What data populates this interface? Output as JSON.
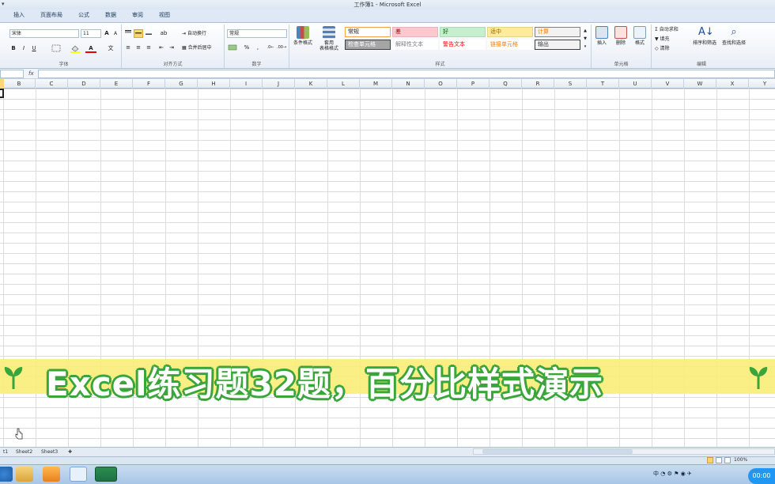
{
  "window": {
    "title": "工作簿1 - Microsoft Excel"
  },
  "tabs": [
    "插入",
    "页面布局",
    "公式",
    "数据",
    "审阅",
    "视图"
  ],
  "ribbon": {
    "font": {
      "name": "宋体",
      "size": "11",
      "grow": "A",
      "shrink": "A",
      "bold": "B",
      "italic": "I",
      "underline": "U",
      "label": "字体"
    },
    "alignment": {
      "wrap": "自动换行",
      "merge": "合并后居中",
      "label": "对齐方式"
    },
    "number": {
      "format": "常规",
      "percent": "%",
      "comma": ",",
      "label": "数字"
    },
    "styles": {
      "conditional": "条件格式",
      "table_line1": "套用",
      "table_line2": "表格格式",
      "cells": [
        {
          "text": "常规",
          "bg": "#ffffff",
          "color": "#222222",
          "border": "#f5a64a"
        },
        {
          "text": "差",
          "bg": "#ffc7ce",
          "color": "#9c0006",
          "border": "#e8b3ba"
        },
        {
          "text": "好",
          "bg": "#c6efce",
          "color": "#006100",
          "border": "#aed8b6"
        },
        {
          "text": "适中",
          "bg": "#ffeb9c",
          "color": "#9c6500",
          "border": "#e6d38a"
        },
        {
          "text": "计算",
          "bg": "#f2f2f2",
          "color": "#fa7d00",
          "border": "#7f7f7f"
        },
        {
          "text": "检查单元格",
          "bg": "#a5a5a5",
          "color": "#ffffff",
          "border": "#3f3f3f"
        },
        {
          "text": "解释性文本",
          "bg": "#ffffff",
          "color": "#7f7f7f",
          "border": "#ffffff"
        },
        {
          "text": "警告文本",
          "bg": "#ffffff",
          "color": "#ff0000",
          "border": "#ffffff"
        },
        {
          "text": "链接单元格",
          "bg": "#ffffff",
          "color": "#fa7d00",
          "border": "#ffffff"
        },
        {
          "text": "输出",
          "bg": "#f2f2f2",
          "color": "#3f3f3f",
          "border": "#3f3f3f"
        }
      ],
      "label": "样式"
    },
    "cells": {
      "insert": "插入",
      "delete": "删除",
      "format": "格式",
      "label": "单元格"
    },
    "editing": {
      "autosum": "自动求和",
      "fill": "填充",
      "clear": "清除",
      "sort": "排序和筛选",
      "find": "查找和选择",
      "label": "编辑"
    }
  },
  "formula_bar": {
    "fx": "fx"
  },
  "columns": [
    "B",
    "C",
    "D",
    "E",
    "F",
    "G",
    "H",
    "I",
    "J",
    "K",
    "L",
    "M",
    "N",
    "O",
    "P",
    "Q",
    "R",
    "S",
    "T",
    "U",
    "V",
    "W",
    "X",
    "Y"
  ],
  "banner": {
    "text": "Excel练习题32题，百分比样式演示"
  },
  "sheets": [
    "t1",
    "Sheet2",
    "Sheet3"
  ],
  "status": {
    "zoom": "100%"
  },
  "taskbar": {
    "ime": "中",
    "clock": "00:00"
  },
  "colors": {
    "accent_green": "#3aa53a",
    "banner_yellow": "#f9ee7a",
    "excel_green": "#1e7145"
  }
}
